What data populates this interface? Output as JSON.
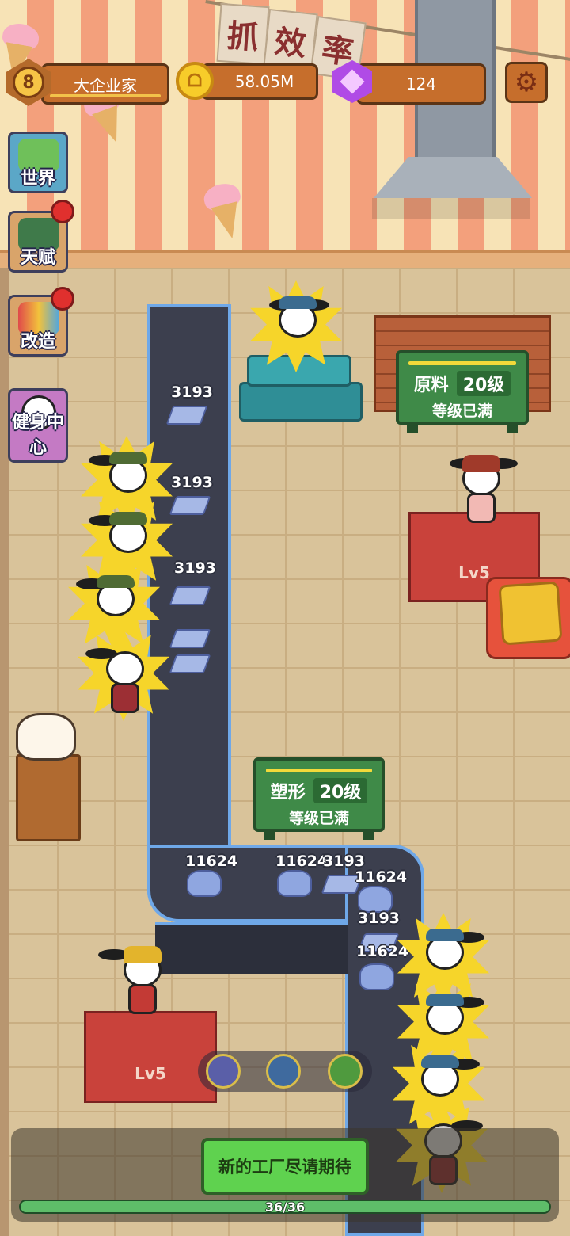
{
  "hud": {
    "level": "8",
    "title": "大企业家",
    "coins": "58.05M",
    "gems": "124",
    "settings_icon": "gear-icon",
    "coin_icon": "rabbit-coin-icon",
    "gem_icon": "purple-gem-icon"
  },
  "banner_text": [
    "抓",
    "效",
    "率"
  ],
  "side_menu": [
    {
      "label": "世界",
      "icon": "world-map-icon",
      "badge": false
    },
    {
      "label": "天赋",
      "icon": "talent-icon",
      "badge": true
    },
    {
      "label": "改造",
      "icon": "remodel-icon",
      "badge": true
    },
    {
      "label": "健身中心",
      "icon": "gym-icon",
      "badge": false
    }
  ],
  "boards": {
    "raw": {
      "name": "原料",
      "level": "20级",
      "status": "等级已满"
    },
    "shape": {
      "name": "塑形",
      "level": "20级",
      "status": "等级已满"
    }
  },
  "podiums": {
    "right": {
      "level": "Lv5"
    },
    "left": {
      "level": "Lv5"
    }
  },
  "conveyor_values": {
    "v1": "3193",
    "v2": "3193",
    "v3": "3193",
    "b1": "11624",
    "b2": "11624",
    "b3": "3193",
    "b4": "11624",
    "b5": "3193",
    "b6": "11624"
  },
  "skills": [
    "blaster-skill-icon",
    "swirl-skill-icon",
    "turtle-skill-icon"
  ],
  "footer": {
    "cta": "新的工厂尽请期待",
    "progress_text": "36/36",
    "progress": 1.0
  },
  "colors": {
    "accent_orange": "#c66e2c",
    "board_green": "#3f8a48",
    "belt_dark": "#3c3f4e",
    "belt_edge": "#6fa8e8",
    "cta_green": "#5fd24f"
  }
}
